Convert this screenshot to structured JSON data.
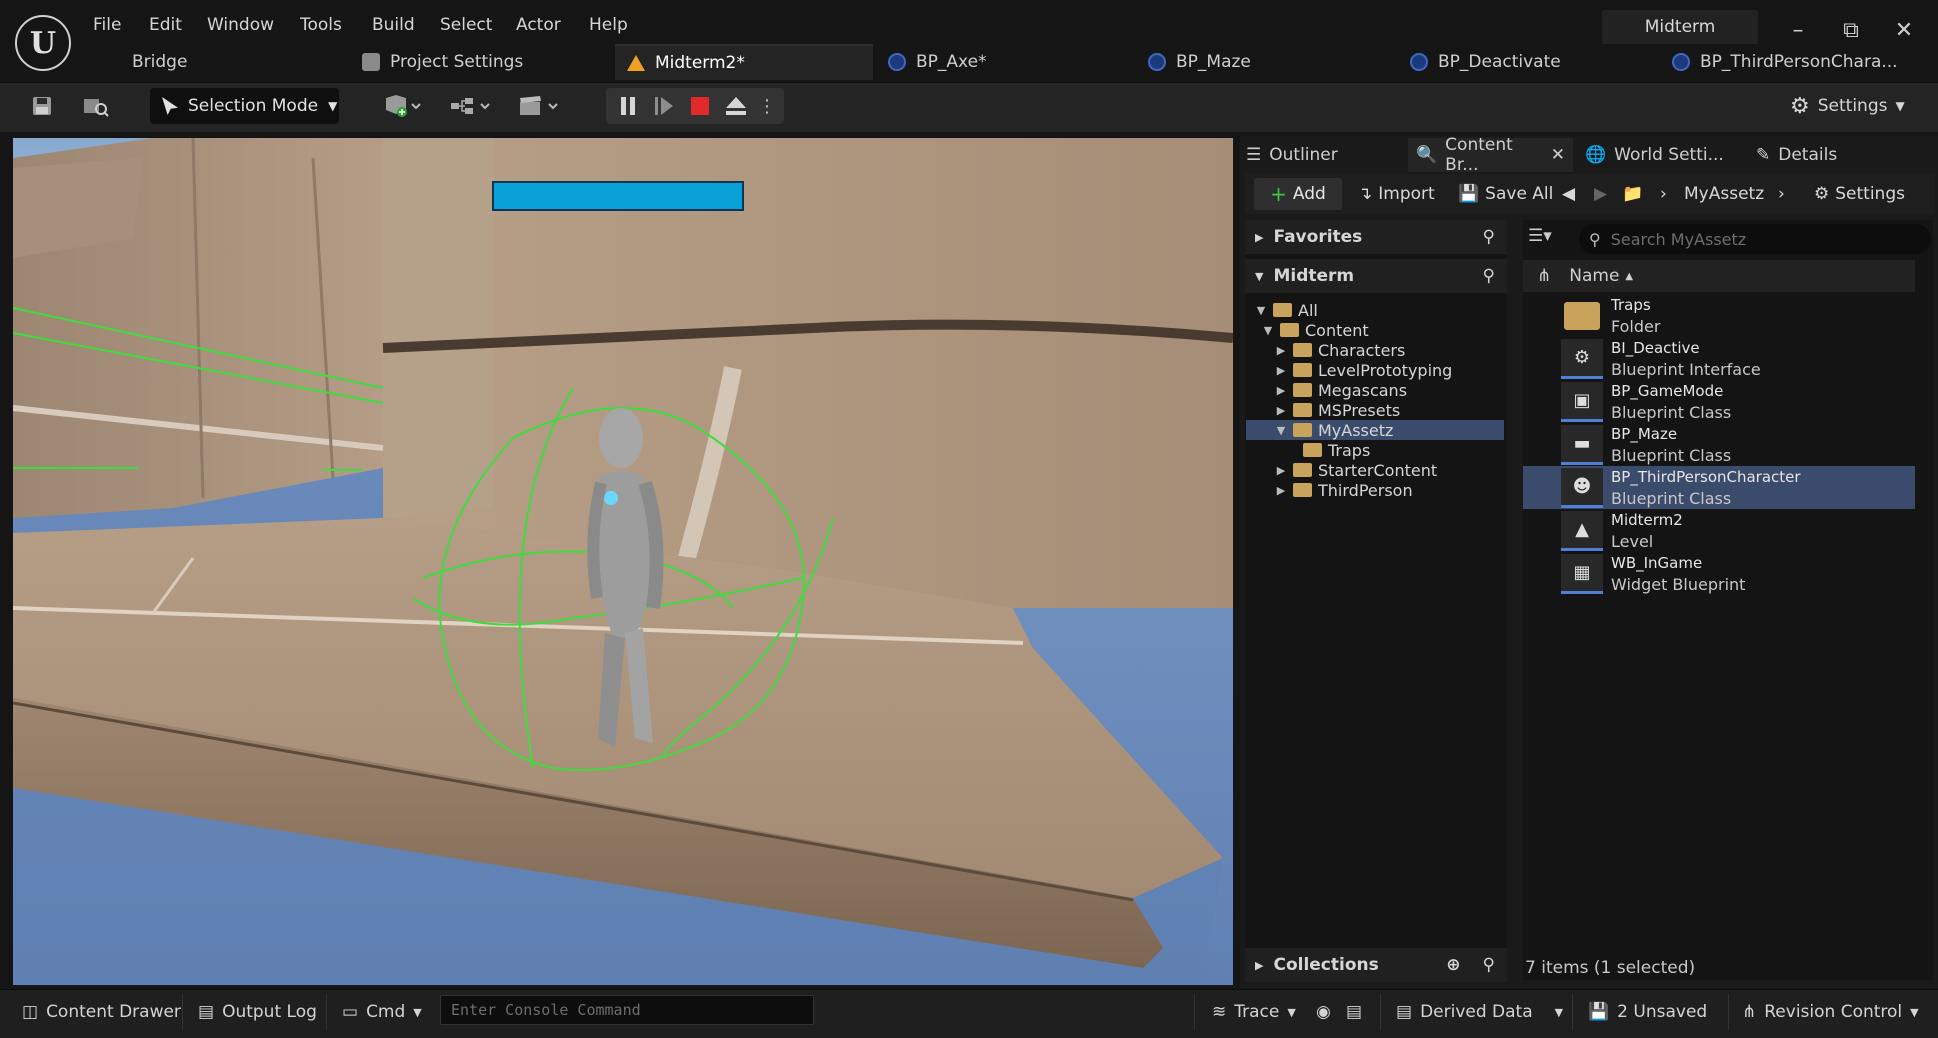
{
  "app": {
    "project_name": "Midterm"
  },
  "menu": [
    "File",
    "Edit",
    "Window",
    "Tools",
    "Build",
    "Select",
    "Actor",
    "Help"
  ],
  "tabs": [
    {
      "label": "Bridge",
      "icon": "none"
    },
    {
      "label": "Project Settings",
      "icon": "settings-icon"
    },
    {
      "label": "Midterm2*",
      "icon": "level-icon",
      "active": true
    },
    {
      "label": "BP_Axe*",
      "icon": "blueprint-icon"
    },
    {
      "label": "BP_Maze",
      "icon": "blueprint-icon"
    },
    {
      "label": "BP_Deactivate",
      "icon": "blueprint-icon"
    },
    {
      "label": "BP_ThirdPersonChara...",
      "icon": "blueprint-icon"
    }
  ],
  "toolbar": {
    "selection_mode": "Selection Mode",
    "settings": "Settings"
  },
  "panel_tabs": {
    "outliner": "Outliner",
    "content_browser": "Content Br...",
    "world_settings": "World Setti...",
    "details": "Details"
  },
  "content_browser": {
    "add": "Add",
    "import": "Import",
    "save_all": "Save All",
    "path": "MyAssetz",
    "settings": "Settings",
    "search_placeholder": "Search MyAssetz",
    "favorites": "Favorites",
    "root": "Midterm",
    "collections": "Collections",
    "name_header": "Name",
    "item_count": "7 items (1 selected)"
  },
  "tree": [
    {
      "label": "All",
      "depth": 0,
      "expanded": true
    },
    {
      "label": "Content",
      "depth": 1,
      "expanded": true
    },
    {
      "label": "Characters",
      "depth": 2
    },
    {
      "label": "LevelPrototyping",
      "depth": 2
    },
    {
      "label": "Megascans",
      "depth": 2
    },
    {
      "label": "MSPresets",
      "depth": 2
    },
    {
      "label": "MyAssetz",
      "depth": 2,
      "expanded": true,
      "selected": true
    },
    {
      "label": "Traps",
      "depth": 3
    },
    {
      "label": "StarterContent",
      "depth": 2
    },
    {
      "label": "ThirdPerson",
      "depth": 2
    }
  ],
  "assets": [
    {
      "name": "Traps",
      "type": "Folder",
      "icon": "folder-icon"
    },
    {
      "name": "BI_Deactive",
      "type": "Blueprint Interface",
      "icon": "interface-icon"
    },
    {
      "name": "BP_GameMode",
      "type": "Blueprint Class",
      "icon": "gamemode-icon"
    },
    {
      "name": "BP_Maze",
      "type": "Blueprint Class",
      "icon": "blueprint-icon"
    },
    {
      "name": "BP_ThirdPersonCharacter",
      "type": "Blueprint Class",
      "icon": "character-icon",
      "selected": true
    },
    {
      "name": "Midterm2",
      "type": "Level",
      "icon": "level-icon"
    },
    {
      "name": "WB_InGame",
      "type": "Widget Blueprint",
      "icon": "widget-icon"
    }
  ],
  "bottom": {
    "content_drawer": "Content Drawer",
    "output_log": "Output Log",
    "cmd": "Cmd",
    "console_placeholder": "Enter Console Command",
    "trace": "Trace",
    "derived_data": "Derived Data",
    "unsaved": "2 Unsaved",
    "revision_control": "Revision Control"
  },
  "colors": {
    "accent_blue": "#0aa0d8",
    "selection": "#3b4b6b",
    "sky": "#6f8fbf",
    "stone": "#a88e78",
    "collision": "#3fdc3f"
  }
}
